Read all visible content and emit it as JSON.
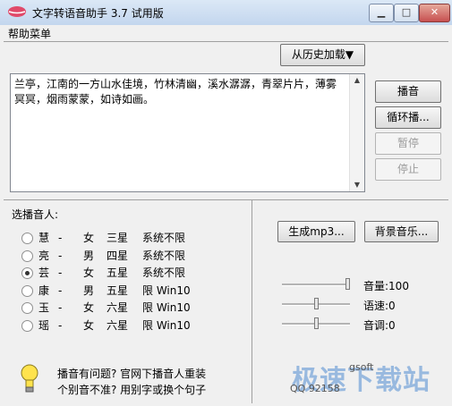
{
  "window": {
    "title": "文字转语音助手 3.7 试用版",
    "controls": [
      "▁",
      "□",
      "✕"
    ]
  },
  "menu": {
    "help": "帮助菜单"
  },
  "history_button": "从历史加载▼",
  "text_input": "兰亭，江南的一方山水佳境，竹林清幽，溪水潺潺，青翠片片，薄雾冥冥，烟雨蒙蒙，如诗如画。",
  "actions": {
    "play": "播音",
    "loop": "循环播...",
    "pause": "暂停",
    "stop": "停止"
  },
  "voice_section": {
    "label": "选播音人:",
    "voices": [
      {
        "name": "慧",
        "dash": "-",
        "gender": "女",
        "stars": "三星",
        "limit": "系统不限",
        "selected": false
      },
      {
        "name": "亮",
        "dash": "-",
        "gender": "男",
        "stars": "四星",
        "limit": "系统不限",
        "selected": false
      },
      {
        "name": "芸",
        "dash": "-",
        "gender": "女",
        "stars": "五星",
        "limit": "系统不限",
        "selected": true
      },
      {
        "name": "康",
        "dash": "-",
        "gender": "男",
        "stars": "五星",
        "limit": "限 Win10",
        "selected": false
      },
      {
        "name": "玉",
        "dash": "-",
        "gender": "女",
        "stars": "六星",
        "limit": "限 Win10",
        "selected": false
      },
      {
        "name": "瑶",
        "dash": "-",
        "gender": "女",
        "stars": "六星",
        "limit": "限 Win10",
        "selected": false
      }
    ]
  },
  "generate": {
    "mp3": "生成mp3...",
    "bg_music": "背景音乐..."
  },
  "sliders": [
    {
      "label": "音量:100",
      "value_fraction": 1.0
    },
    {
      "label": "语速:0",
      "value_fraction": 0.5
    },
    {
      "label": "音调:0",
      "value_fraction": 0.5
    }
  ],
  "tip": {
    "line1": "播音有问题? 官网下播音人重装",
    "line2": "个别音不准? 用别字或换个句子"
  },
  "watermark": {
    "main": "极速下载站",
    "sub1": "gsoft",
    "sub2": "QQ 92158"
  },
  "colors": {
    "titlebar": "#c3d6ee",
    "close": "#c75050",
    "watermark": "#508cd2"
  }
}
